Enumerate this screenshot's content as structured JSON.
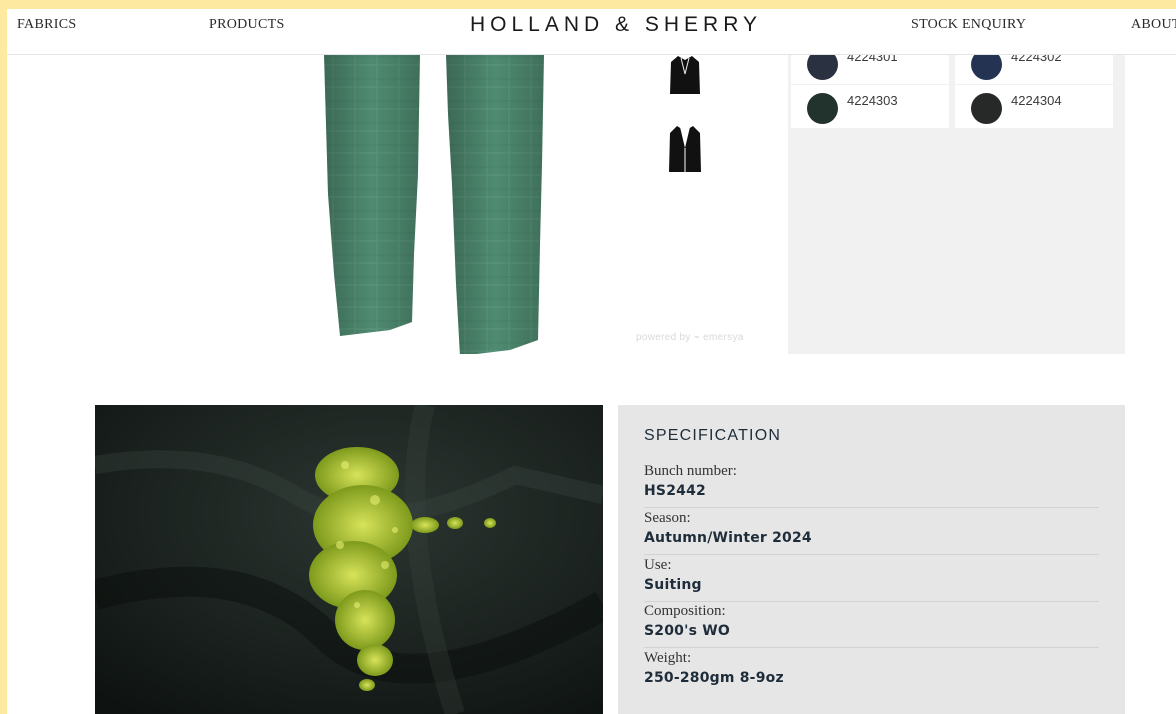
{
  "nav": {
    "fabrics": "FABRICS",
    "products": "PRODUCTS",
    "brand": "HOLLAND & SHERRY",
    "stock_enquiry": "STOCK ENQUIRY",
    "about": "ABOUT"
  },
  "viewer": {
    "powered_by": "powered by ⌁ emersya",
    "thumbnails": [
      "jacket-front-icon",
      "jacket-open-icon"
    ]
  },
  "colours": [
    {
      "code": "4224301",
      "color": "#2a3140"
    },
    {
      "code": "4224302",
      "color": "#243352"
    },
    {
      "code": "4224303",
      "color": "#22332d"
    },
    {
      "code": "4224304",
      "color": "#262928"
    }
  ],
  "specification": {
    "title": "SPECIFICATION",
    "rows": [
      {
        "label": "Bunch number:",
        "value": "HS2442"
      },
      {
        "label": "Season:",
        "value": "Autumn/Winter 2024"
      },
      {
        "label": "Use:",
        "value": "Suiting"
      },
      {
        "label": "Composition:",
        "value": "S200's WO"
      },
      {
        "label": "Weight:",
        "value": "250-280gm 8-9oz"
      }
    ]
  },
  "theme": {
    "frame": "#fde9a0",
    "trouser_green": "#4e8a70",
    "spec_bg": "#e6e6e6",
    "panel_bg": "#f1f1f1"
  }
}
